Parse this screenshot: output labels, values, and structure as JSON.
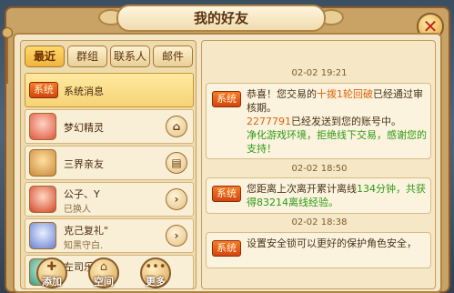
{
  "window": {
    "title": "我的好友",
    "close_label": "✕"
  },
  "tabs": [
    {
      "label": "最近",
      "active": true
    },
    {
      "label": "群组",
      "active": false
    },
    {
      "label": "联系人",
      "active": false
    },
    {
      "label": "邮件",
      "active": false
    }
  ],
  "contacts": [
    {
      "badge": "系统",
      "name": "系统消息",
      "sub": ""
    },
    {
      "name": "梦幻精灵",
      "sub": "",
      "action_icon": "house-icon"
    },
    {
      "name": "三界亲友",
      "sub": "",
      "action_icon": "book-icon"
    },
    {
      "name": "公子、Y",
      "sub": "已换人",
      "action_icon": "chevron-right-icon"
    },
    {
      "name": "克己复礼\"",
      "sub": "知黑守白.",
      "action_icon": "chevron-right-icon"
    },
    {
      "name": "左司乐",
      "sub": ""
    }
  ],
  "bottom_buttons": [
    {
      "label": "添加"
    },
    {
      "label": "空间"
    },
    {
      "label": "更多"
    }
  ],
  "messages": [
    {
      "time": "02-02 19:21",
      "badge": "系统",
      "parts": {
        "a": "恭喜！您交易的",
        "b": "十拨1轮回破",
        "c": "已经通过审核期。",
        "d": "2277791",
        "e": "已经发送到您的账号中。",
        "f": "净化游戏环境，拒绝线下交易，感谢您的支持！"
      }
    },
    {
      "time": "02-02 18:50",
      "badge": "系统",
      "parts": {
        "a": "您距离上次离开累计离线",
        "b": "134分钟",
        "c": "，共获得",
        "d": "83214",
        "e": "离线经验。"
      }
    },
    {
      "time": "02-02 18:38",
      "badge": "系统",
      "parts": {
        "a": "设置安全锁可以更好的保护角色安全，"
      }
    }
  ],
  "colors": {
    "accent_orange": "#e0620c",
    "accent_green": "#2f9a16",
    "badge_orange": "#f77b2a"
  }
}
